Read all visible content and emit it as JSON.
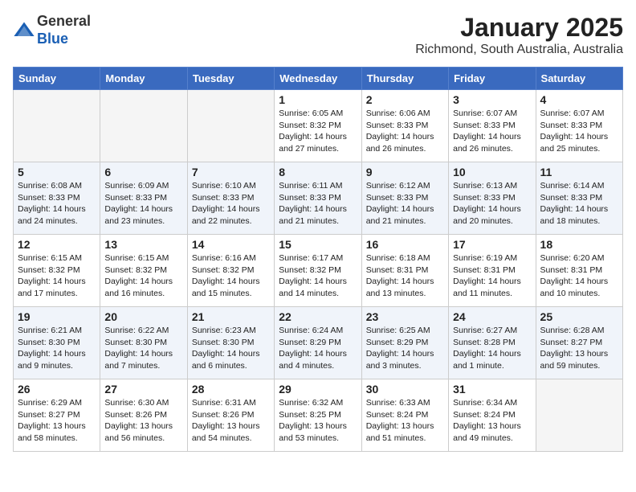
{
  "header": {
    "logo_line1": "General",
    "logo_line2": "Blue",
    "title": "January 2025",
    "subtitle": "Richmond, South Australia, Australia"
  },
  "weekdays": [
    "Sunday",
    "Monday",
    "Tuesday",
    "Wednesday",
    "Thursday",
    "Friday",
    "Saturday"
  ],
  "weeks": [
    [
      {
        "day": "",
        "empty": true
      },
      {
        "day": "",
        "empty": true
      },
      {
        "day": "",
        "empty": true
      },
      {
        "day": "1",
        "sunrise": "6:05 AM",
        "sunset": "8:32 PM",
        "daylight": "14 hours and 27 minutes."
      },
      {
        "day": "2",
        "sunrise": "6:06 AM",
        "sunset": "8:33 PM",
        "daylight": "14 hours and 26 minutes."
      },
      {
        "day": "3",
        "sunrise": "6:07 AM",
        "sunset": "8:33 PM",
        "daylight": "14 hours and 26 minutes."
      },
      {
        "day": "4",
        "sunrise": "6:07 AM",
        "sunset": "8:33 PM",
        "daylight": "14 hours and 25 minutes."
      }
    ],
    [
      {
        "day": "5",
        "sunrise": "6:08 AM",
        "sunset": "8:33 PM",
        "daylight": "14 hours and 24 minutes."
      },
      {
        "day": "6",
        "sunrise": "6:09 AM",
        "sunset": "8:33 PM",
        "daylight": "14 hours and 23 minutes."
      },
      {
        "day": "7",
        "sunrise": "6:10 AM",
        "sunset": "8:33 PM",
        "daylight": "14 hours and 22 minutes."
      },
      {
        "day": "8",
        "sunrise": "6:11 AM",
        "sunset": "8:33 PM",
        "daylight": "14 hours and 21 minutes."
      },
      {
        "day": "9",
        "sunrise": "6:12 AM",
        "sunset": "8:33 PM",
        "daylight": "14 hours and 21 minutes."
      },
      {
        "day": "10",
        "sunrise": "6:13 AM",
        "sunset": "8:33 PM",
        "daylight": "14 hours and 20 minutes."
      },
      {
        "day": "11",
        "sunrise": "6:14 AM",
        "sunset": "8:33 PM",
        "daylight": "14 hours and 18 minutes."
      }
    ],
    [
      {
        "day": "12",
        "sunrise": "6:15 AM",
        "sunset": "8:32 PM",
        "daylight": "14 hours and 17 minutes."
      },
      {
        "day": "13",
        "sunrise": "6:15 AM",
        "sunset": "8:32 PM",
        "daylight": "14 hours and 16 minutes."
      },
      {
        "day": "14",
        "sunrise": "6:16 AM",
        "sunset": "8:32 PM",
        "daylight": "14 hours and 15 minutes."
      },
      {
        "day": "15",
        "sunrise": "6:17 AM",
        "sunset": "8:32 PM",
        "daylight": "14 hours and 14 minutes."
      },
      {
        "day": "16",
        "sunrise": "6:18 AM",
        "sunset": "8:31 PM",
        "daylight": "14 hours and 13 minutes."
      },
      {
        "day": "17",
        "sunrise": "6:19 AM",
        "sunset": "8:31 PM",
        "daylight": "14 hours and 11 minutes."
      },
      {
        "day": "18",
        "sunrise": "6:20 AM",
        "sunset": "8:31 PM",
        "daylight": "14 hours and 10 minutes."
      }
    ],
    [
      {
        "day": "19",
        "sunrise": "6:21 AM",
        "sunset": "8:30 PM",
        "daylight": "14 hours and 9 minutes."
      },
      {
        "day": "20",
        "sunrise": "6:22 AM",
        "sunset": "8:30 PM",
        "daylight": "14 hours and 7 minutes."
      },
      {
        "day": "21",
        "sunrise": "6:23 AM",
        "sunset": "8:30 PM",
        "daylight": "14 hours and 6 minutes."
      },
      {
        "day": "22",
        "sunrise": "6:24 AM",
        "sunset": "8:29 PM",
        "daylight": "14 hours and 4 minutes."
      },
      {
        "day": "23",
        "sunrise": "6:25 AM",
        "sunset": "8:29 PM",
        "daylight": "14 hours and 3 minutes."
      },
      {
        "day": "24",
        "sunrise": "6:27 AM",
        "sunset": "8:28 PM",
        "daylight": "14 hours and 1 minute."
      },
      {
        "day": "25",
        "sunrise": "6:28 AM",
        "sunset": "8:27 PM",
        "daylight": "13 hours and 59 minutes."
      }
    ],
    [
      {
        "day": "26",
        "sunrise": "6:29 AM",
        "sunset": "8:27 PM",
        "daylight": "13 hours and 58 minutes."
      },
      {
        "day": "27",
        "sunrise": "6:30 AM",
        "sunset": "8:26 PM",
        "daylight": "13 hours and 56 minutes."
      },
      {
        "day": "28",
        "sunrise": "6:31 AM",
        "sunset": "8:26 PM",
        "daylight": "13 hours and 54 minutes."
      },
      {
        "day": "29",
        "sunrise": "6:32 AM",
        "sunset": "8:25 PM",
        "daylight": "13 hours and 53 minutes."
      },
      {
        "day": "30",
        "sunrise": "6:33 AM",
        "sunset": "8:24 PM",
        "daylight": "13 hours and 51 minutes."
      },
      {
        "day": "31",
        "sunrise": "6:34 AM",
        "sunset": "8:24 PM",
        "daylight": "13 hours and 49 minutes."
      },
      {
        "day": "",
        "empty": true
      }
    ]
  ],
  "labels": {
    "sunrise_prefix": "Sunrise: ",
    "sunset_prefix": "Sunset: ",
    "daylight_prefix": "Daylight: "
  }
}
